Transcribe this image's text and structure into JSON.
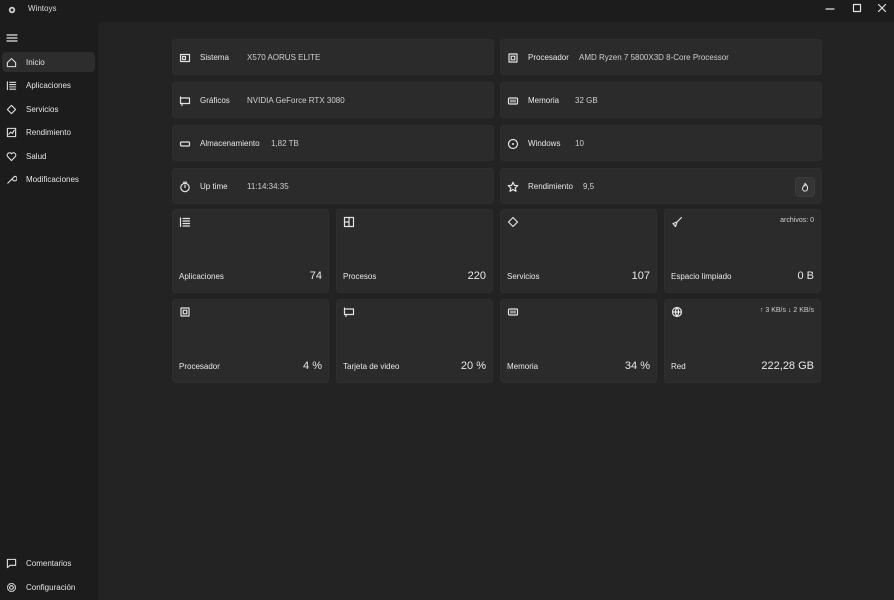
{
  "window": {
    "title": "Wintoys",
    "controls": [
      "minimize-icon",
      "maximize-icon",
      "close-icon"
    ]
  },
  "sidebar": {
    "menu_icon": "hamburger-icon",
    "items": [
      {
        "label": "Inicio",
        "icon": "home-icon",
        "active": true
      },
      {
        "label": "Aplicaciones",
        "icon": "apps-list-icon"
      },
      {
        "label": "Servicios",
        "icon": "services-icon"
      },
      {
        "label": "Rendimiento",
        "icon": "performance-icon"
      },
      {
        "label": "Salud",
        "icon": "health-heart-icon"
      },
      {
        "label": "Modificaciones",
        "icon": "wrench-icon"
      }
    ],
    "bottom_items": [
      {
        "label": "Comentarios",
        "icon": "feedback-icon"
      },
      {
        "label": "Configuración",
        "icon": "settings-gear-icon"
      }
    ]
  },
  "info": {
    "sistema": {
      "label": "Sistema",
      "value": "X570 AORUS ELITE"
    },
    "procesador": {
      "label": "Procesador",
      "value": "AMD Ryzen 7 5800X3D 8-Core Processor"
    },
    "graficos": {
      "label": "Gráficos",
      "value": "NVIDIA GeForce RTX 3080"
    },
    "memoria": {
      "label": "Memoria",
      "value": "32 GB"
    },
    "almacenamiento": {
      "label": "Almacenamiento",
      "value": "1,82 TB"
    },
    "windows": {
      "label": "Windows",
      "value": "10"
    },
    "uptime": {
      "label": "Up time",
      "value": "11:14:34:35"
    },
    "rendimiento": {
      "label": "Rendimiento",
      "value": "9,5"
    }
  },
  "stats": {
    "aplicaciones": {
      "label": "Aplicaciones",
      "value": "74"
    },
    "procesos": {
      "label": "Procesos",
      "value": "220"
    },
    "servicios": {
      "label": "Servicios",
      "value": "107"
    },
    "espacio": {
      "label": "Espacio limpiado",
      "value": "0 B",
      "extra": "archivos: 0"
    },
    "procesador": {
      "label": "Procesador",
      "value": "4 %"
    },
    "tarjeta": {
      "label": "Tarjeta de video",
      "value": "20 %"
    },
    "memoria": {
      "label": "Memoria",
      "value": "34 %"
    },
    "red": {
      "label": "Red",
      "value": "222,28 GB",
      "extra": "↑ 3 KB/s  ↓ 2 KB/s"
    }
  },
  "colors": {
    "background": "#1c1c1c",
    "content": "#232323",
    "card": "#2b2b2b",
    "text": "#e6e6e6"
  }
}
